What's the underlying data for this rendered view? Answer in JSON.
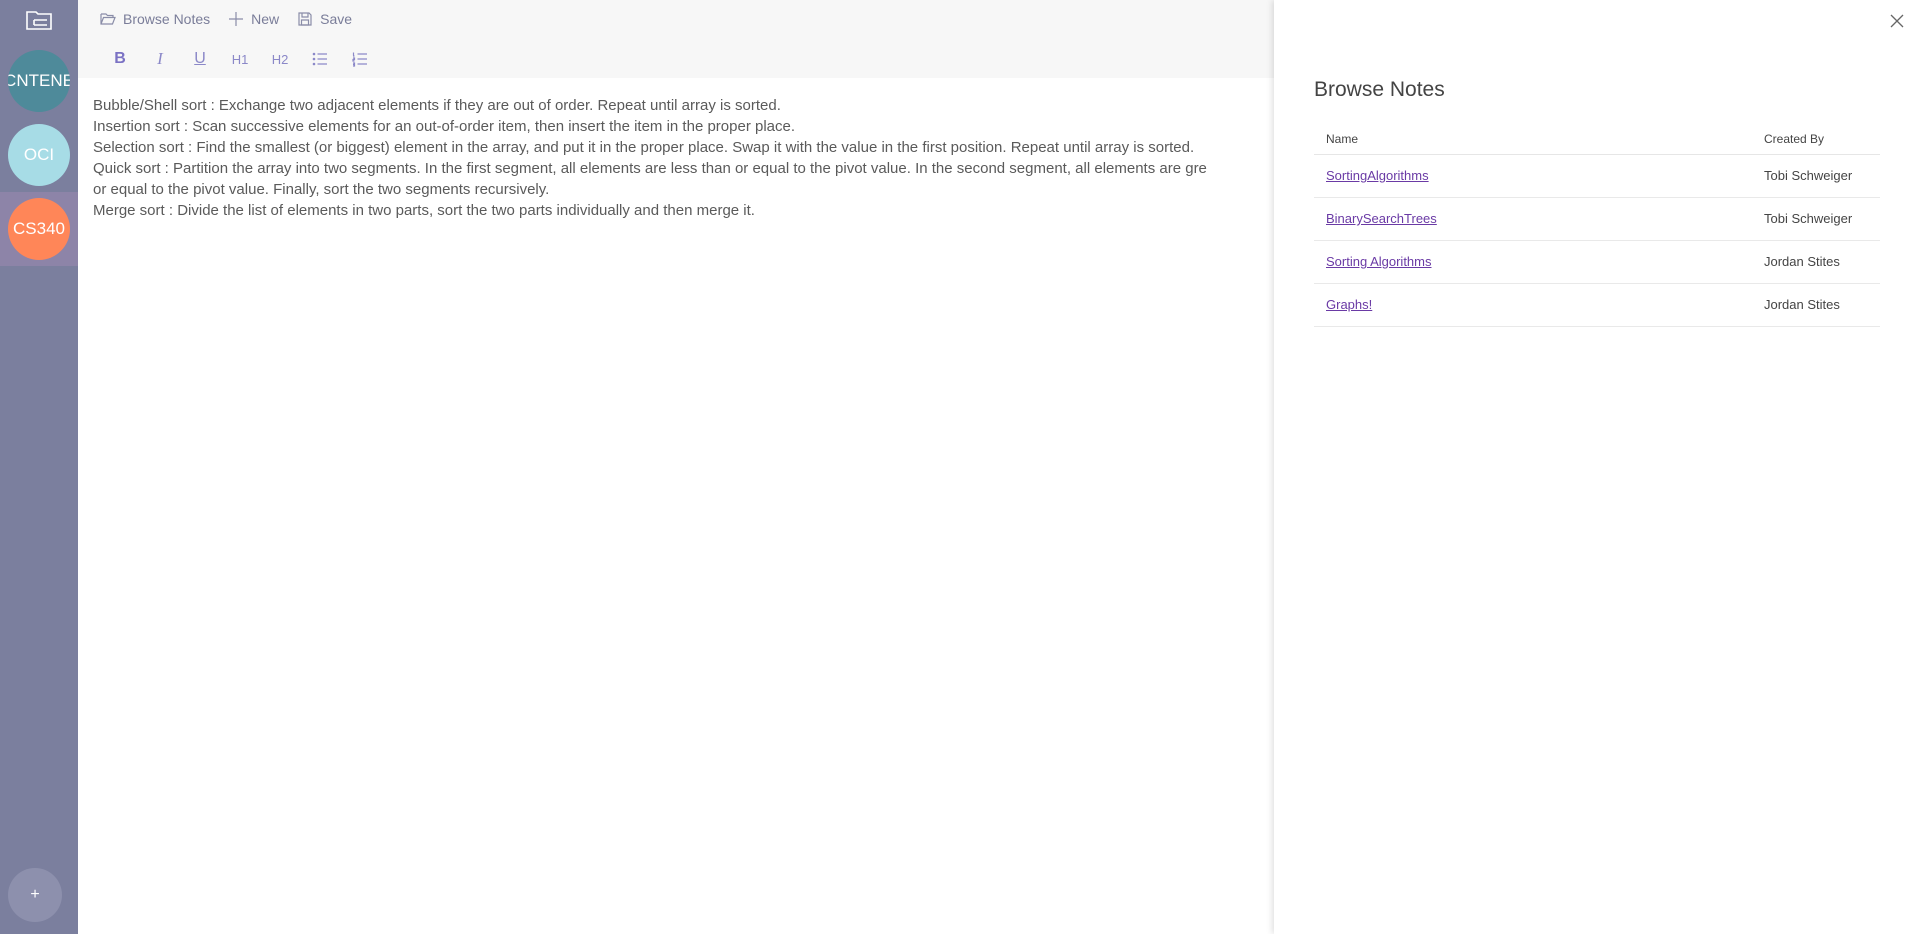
{
  "rail": {
    "teams": [
      {
        "label": "CNTENE",
        "color": "#4e8a9a"
      },
      {
        "label": "OCI",
        "color": "#a7dce6"
      },
      {
        "label": "CS340",
        "color": "#ff8658"
      }
    ],
    "add_label": "+"
  },
  "toolbar": {
    "browse_label": "Browse Notes",
    "new_label": "New",
    "save_label": "Save",
    "format": {
      "bold": "B",
      "italic": "I",
      "underline": "U",
      "h1": "H1",
      "h2": "H2"
    }
  },
  "editor": {
    "lines": [
      "Bubble/Shell sort : Exchange two adjacent elements if they are out of order. Repeat until array is sorted.",
      "Insertion sort : Scan successive elements for an out-of-order item, then insert the item in the proper place.",
      "Selection sort : Find the smallest (or biggest) element in the array, and put it in the proper place. Swap it with the value in the first position. Repeat until array is sorted.",
      "Quick sort : Partition the array into two segments. In the first segment, all elements are less than or equal to the pivot value. In the second segment, all elements are gre",
      "or equal to the pivot value. Finally, sort the two segments recursively.",
      "Merge sort : Divide the list of elements in two parts, sort the two parts individually and then merge it."
    ]
  },
  "panel": {
    "title": "Browse Notes",
    "columns": {
      "name": "Name",
      "created_by": "Created By"
    },
    "rows": [
      {
        "name": "SortingAlgorithms",
        "created_by": "Tobi Schweiger"
      },
      {
        "name": "BinarySearchTrees",
        "created_by": "Tobi Schweiger"
      },
      {
        "name": "Sorting Algorithms",
        "created_by": "Jordan Stites"
      },
      {
        "name": "Graphs!",
        "created_by": "Jordan Stites"
      }
    ]
  },
  "colors": {
    "rail_bg": "#7b7f9e",
    "accent": "#7b72c4",
    "link": "#6a3aa5"
  }
}
